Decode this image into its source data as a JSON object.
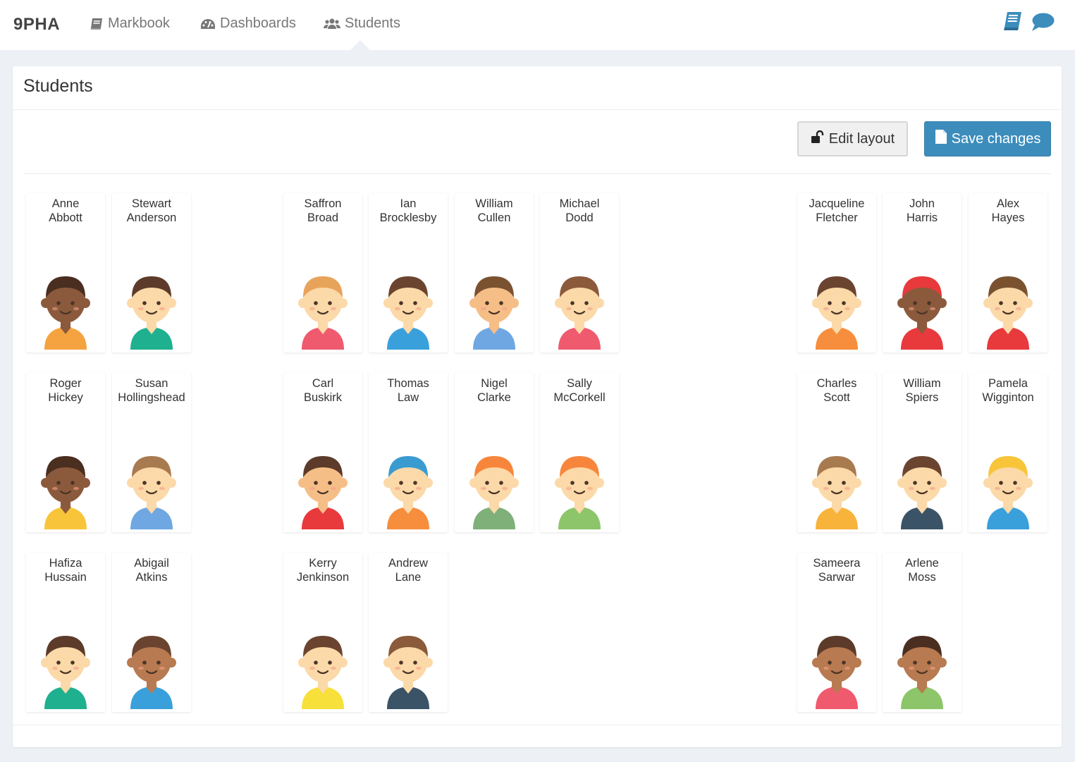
{
  "app": {
    "brand": "9PHA"
  },
  "nav": {
    "items": [
      {
        "label": "Markbook",
        "icon": "book-icon"
      },
      {
        "label": "Dashboards",
        "icon": "dashboard-icon"
      },
      {
        "label": "Students",
        "icon": "users-icon",
        "active": true
      }
    ],
    "right_icons": [
      "markbook-icon",
      "chat-icon"
    ]
  },
  "panel": {
    "title": "Students",
    "edit_button": "Edit layout",
    "save_button": "Save changes"
  },
  "colors": {
    "accent": "#3c8dbc",
    "background": "#edf1f5"
  },
  "students": [
    {
      "first": "Anne",
      "last": "Abbott",
      "skin": "#8b5a3c",
      "hair": "#4a2e20",
      "shirt": "#f5a340"
    },
    {
      "first": "Stewart",
      "last": "Anderson",
      "skin": "#fcd9a8",
      "hair": "#5c3b2a",
      "shirt": "#1fb08f"
    },
    {
      "first": "Saffron",
      "last": "Broad",
      "skin": "#fcd9a8",
      "hair": "#e8a35a",
      "shirt": "#ef5a6f"
    },
    {
      "first": "Ian",
      "last": "Brocklesby",
      "skin": "#fcd9a8",
      "hair": "#6b4430",
      "shirt": "#3aa0dc"
    },
    {
      "first": "William",
      "last": "Cullen",
      "skin": "#f6be87",
      "hair": "#7a5230",
      "shirt": "#6fa7e2"
    },
    {
      "first": "Michael",
      "last": "Dodd",
      "skin": "#fcd9a8",
      "hair": "#8a5a3a",
      "shirt": "#ef5a6f"
    },
    {
      "first": "Jacqueline",
      "last": "Fletcher",
      "skin": "#fcd9a8",
      "hair": "#6b4430",
      "shirt": "#f78e3e"
    },
    {
      "first": "John",
      "last": "Harris",
      "skin": "#8b5a3c",
      "hair": "#e8393c",
      "shirt": "#e8393c"
    },
    {
      "first": "Alex",
      "last": "Hayes",
      "skin": "#fcd9a8",
      "hair": "#7a5230",
      "shirt": "#e8393c"
    },
    {
      "first": "Roger",
      "last": "Hickey",
      "skin": "#8b5a3c",
      "hair": "#4a2e20",
      "shirt": "#f8c53a"
    },
    {
      "first": "Susan",
      "last": "Hollingshead",
      "skin": "#fcd9a8",
      "hair": "#a87a50",
      "shirt": "#6fa7e2"
    },
    {
      "first": "Carl",
      "last": "Buskirk",
      "skin": "#f6be87",
      "hair": "#5c3b2a",
      "shirt": "#e8393c"
    },
    {
      "first": "Thomas",
      "last": "Law",
      "skin": "#fcd9a8",
      "hair": "#3a9bd0",
      "shirt": "#f78e3e"
    },
    {
      "first": "Nigel",
      "last": "Clarke",
      "skin": "#fcd9a8",
      "hair": "#f7863c",
      "shirt": "#7fb07a"
    },
    {
      "first": "Sally",
      "last": "McCorkell",
      "skin": "#fcd9a8",
      "hair": "#f7863c",
      "shirt": "#8cc56a"
    },
    {
      "first": "Charles",
      "last": "Scott",
      "skin": "#fcd9a8",
      "hair": "#a87a50",
      "shirt": "#f8b33a"
    },
    {
      "first": "William",
      "last": "Spiers",
      "skin": "#fcd9a8",
      "hair": "#6b4430",
      "shirt": "#3b5366"
    },
    {
      "first": "Pamela",
      "last": "Wigginton",
      "skin": "#fcd9a8",
      "hair": "#f8c53a",
      "shirt": "#3aa0dc"
    },
    {
      "first": "Hafiza",
      "last": "Hussain",
      "skin": "#fcd9a8",
      "hair": "#5c3b2a",
      "shirt": "#1fb08f"
    },
    {
      "first": "Abigail",
      "last": "Atkins",
      "skin": "#b87a50",
      "hair": "#6b4430",
      "shirt": "#3aa0dc"
    },
    {
      "first": "Kerry",
      "last": "Jenkinson",
      "skin": "#fcd9a8",
      "hair": "#6b4430",
      "shirt": "#f8e03a"
    },
    {
      "first": "Andrew",
      "last": "Lane",
      "skin": "#fcd9a8",
      "hair": "#8a5a3a",
      "shirt": "#3b5366"
    },
    {
      "first": "Sameera",
      "last": "Sarwar",
      "skin": "#b87a50",
      "hair": "#5c3b2a",
      "shirt": "#ef5a6f"
    },
    {
      "first": "Arlene",
      "last": "Moss",
      "skin": "#b87a50",
      "hair": "#4a2e20",
      "shirt": "#8cc56a"
    }
  ]
}
